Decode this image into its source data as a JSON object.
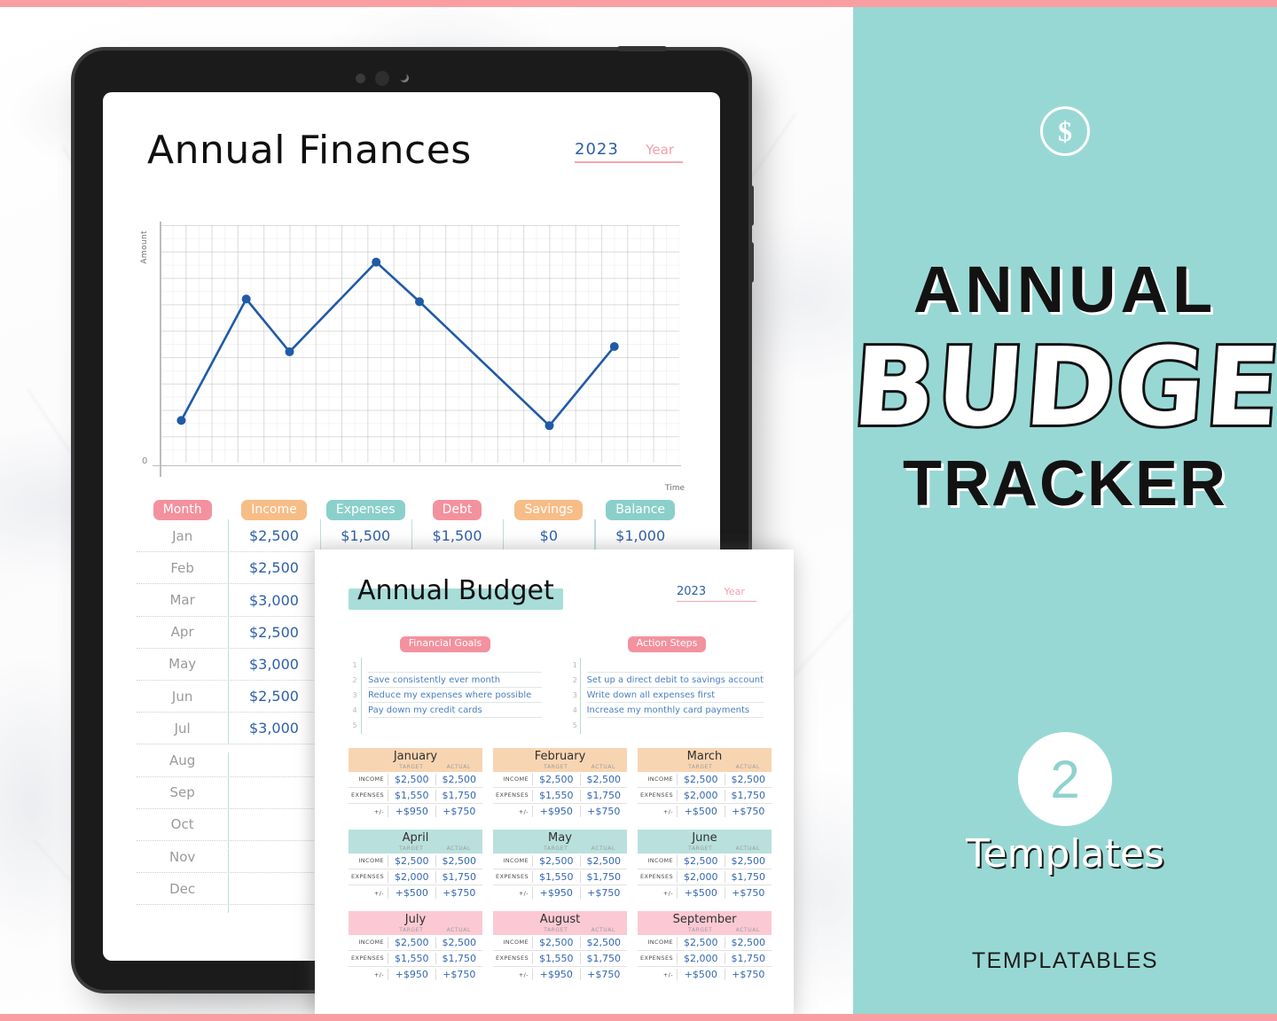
{
  "brand": {
    "name": "TEMPLATABLES"
  },
  "promo": {
    "coin_icon": "dollar-circle-icon",
    "line1": "ANNUAL",
    "line2": "BUDGET",
    "line3": "TRACKER",
    "count": "2",
    "count_label": "Templates",
    "bg_color": "#98d8d4",
    "stripe_color": "#f99fa4"
  },
  "finances": {
    "title": "Annual Finances",
    "year_value": "2023",
    "year_label": "Year",
    "chart": {
      "y_axis_label": "Amount",
      "x_axis_label": "Time",
      "origin_label": "0"
    },
    "columns": [
      {
        "label": "Month",
        "color": "pink"
      },
      {
        "label": "Income",
        "color": "orange"
      },
      {
        "label": "Expenses",
        "color": "teal"
      },
      {
        "label": "Debt",
        "color": "pink"
      },
      {
        "label": "Savings",
        "color": "orange"
      },
      {
        "label": "Balance",
        "color": "teal"
      }
    ],
    "rows": [
      {
        "month": "Jan",
        "income": "$2,500",
        "expenses": "$1,500",
        "debt": "$1,500",
        "savings": "$0",
        "balance": "$1,000"
      },
      {
        "month": "Feb",
        "income": "$2,500",
        "expenses": "",
        "debt": "",
        "savings": "",
        "balance": ""
      },
      {
        "month": "Mar",
        "income": "$3,000",
        "expenses": "",
        "debt": "",
        "savings": "",
        "balance": ""
      },
      {
        "month": "Apr",
        "income": "$2,500",
        "expenses": "",
        "debt": "",
        "savings": "",
        "balance": ""
      },
      {
        "month": "May",
        "income": "$3,000",
        "expenses": "",
        "debt": "",
        "savings": "",
        "balance": ""
      },
      {
        "month": "Jun",
        "income": "$2,500",
        "expenses": "",
        "debt": "",
        "savings": "",
        "balance": ""
      },
      {
        "month": "Jul",
        "income": "$3,000",
        "expenses": "",
        "debt": "",
        "savings": "",
        "balance": ""
      },
      {
        "month": "Aug",
        "income": "",
        "expenses": "",
        "debt": "",
        "savings": "",
        "balance": ""
      },
      {
        "month": "Sep",
        "income": "",
        "expenses": "",
        "debt": "",
        "savings": "",
        "balance": ""
      },
      {
        "month": "Oct",
        "income": "",
        "expenses": "",
        "debt": "",
        "savings": "",
        "balance": ""
      },
      {
        "month": "Nov",
        "income": "",
        "expenses": "",
        "debt": "",
        "savings": "",
        "balance": ""
      },
      {
        "month": "Dec",
        "income": "",
        "expenses": "",
        "debt": "",
        "savings": "",
        "balance": ""
      }
    ]
  },
  "budget": {
    "title": "Annual Budget",
    "year_value": "2023",
    "year_label": "Year",
    "goals": {
      "title": "Financial Goals",
      "numbers": [
        "1",
        "2",
        "3",
        "4",
        "5"
      ],
      "items": [
        "",
        "Save consistently ever month",
        "Reduce my expenses where possible",
        "Pay down my credit cards",
        ""
      ]
    },
    "actions": {
      "title": "Action Steps",
      "numbers": [
        "1",
        "2",
        "3",
        "4",
        "5"
      ],
      "items": [
        "",
        "Set up a direct debit to savings account",
        "Write down all expenses first",
        "Increase my monthly card payments",
        ""
      ]
    },
    "col_headers": {
      "label": "",
      "target": "TARGET",
      "actual": "ACTUAL"
    },
    "row_labels": {
      "income": "INCOME",
      "expenses": "EXPENSES",
      "diff": "+/-"
    },
    "months": [
      {
        "name": "January",
        "theme": "orange",
        "income_target": "$2,500",
        "income_actual": "$2,500",
        "expenses_target": "$1,550",
        "expenses_actual": "$1,750",
        "diff_target": "+$950",
        "diff_actual": "+$750"
      },
      {
        "name": "February",
        "theme": "orange",
        "income_target": "$2,500",
        "income_actual": "$2,500",
        "expenses_target": "$1,550",
        "expenses_actual": "$1,750",
        "diff_target": "+$950",
        "diff_actual": "+$750"
      },
      {
        "name": "March",
        "theme": "orange",
        "income_target": "$2,500",
        "income_actual": "$2,500",
        "expenses_target": "$2,000",
        "expenses_actual": "$1,750",
        "diff_target": "+$500",
        "diff_actual": "+$750"
      },
      {
        "name": "April",
        "theme": "teal",
        "income_target": "$2,500",
        "income_actual": "$2,500",
        "expenses_target": "$2,000",
        "expenses_actual": "$1,750",
        "diff_target": "+$500",
        "diff_actual": "+$750"
      },
      {
        "name": "May",
        "theme": "teal",
        "income_target": "$2,500",
        "income_actual": "$2,500",
        "expenses_target": "$1,550",
        "expenses_actual": "$1,750",
        "diff_target": "+$950",
        "diff_actual": "+$750"
      },
      {
        "name": "June",
        "theme": "teal",
        "income_target": "$2,500",
        "income_actual": "$2,500",
        "expenses_target": "$2,000",
        "expenses_actual": "$1,750",
        "diff_target": "+$500",
        "diff_actual": "+$750"
      },
      {
        "name": "July",
        "theme": "pink",
        "income_target": "$2,500",
        "income_actual": "$2,500",
        "expenses_target": "$1,550",
        "expenses_actual": "$1,750",
        "diff_target": "+$950",
        "diff_actual": "+$750"
      },
      {
        "name": "August",
        "theme": "pink",
        "income_target": "$2,500",
        "income_actual": "$2,500",
        "expenses_target": "$1,550",
        "expenses_actual": "$1,750",
        "diff_target": "+$950",
        "diff_actual": "+$750"
      },
      {
        "name": "September",
        "theme": "pink",
        "income_target": "$2,500",
        "income_actual": "$2,500",
        "expenses_target": "$2,000",
        "expenses_actual": "$1,750",
        "diff_target": "+$500",
        "diff_actual": "+$750"
      }
    ]
  },
  "chart_data": {
    "type": "line",
    "title": "Annual Finances",
    "xlabel": "Time",
    "ylabel": "Amount",
    "x": [
      1,
      4,
      6,
      10,
      12,
      18,
      21
    ],
    "values": [
      1.6,
      6.2,
      4.2,
      7.6,
      6.1,
      1.4,
      4.4
    ],
    "xlim": [
      0,
      24
    ],
    "ylim": [
      0,
      9
    ],
    "grid": true,
    "legend": "none",
    "line_color": "#1f5ba6",
    "marker": "circle"
  }
}
